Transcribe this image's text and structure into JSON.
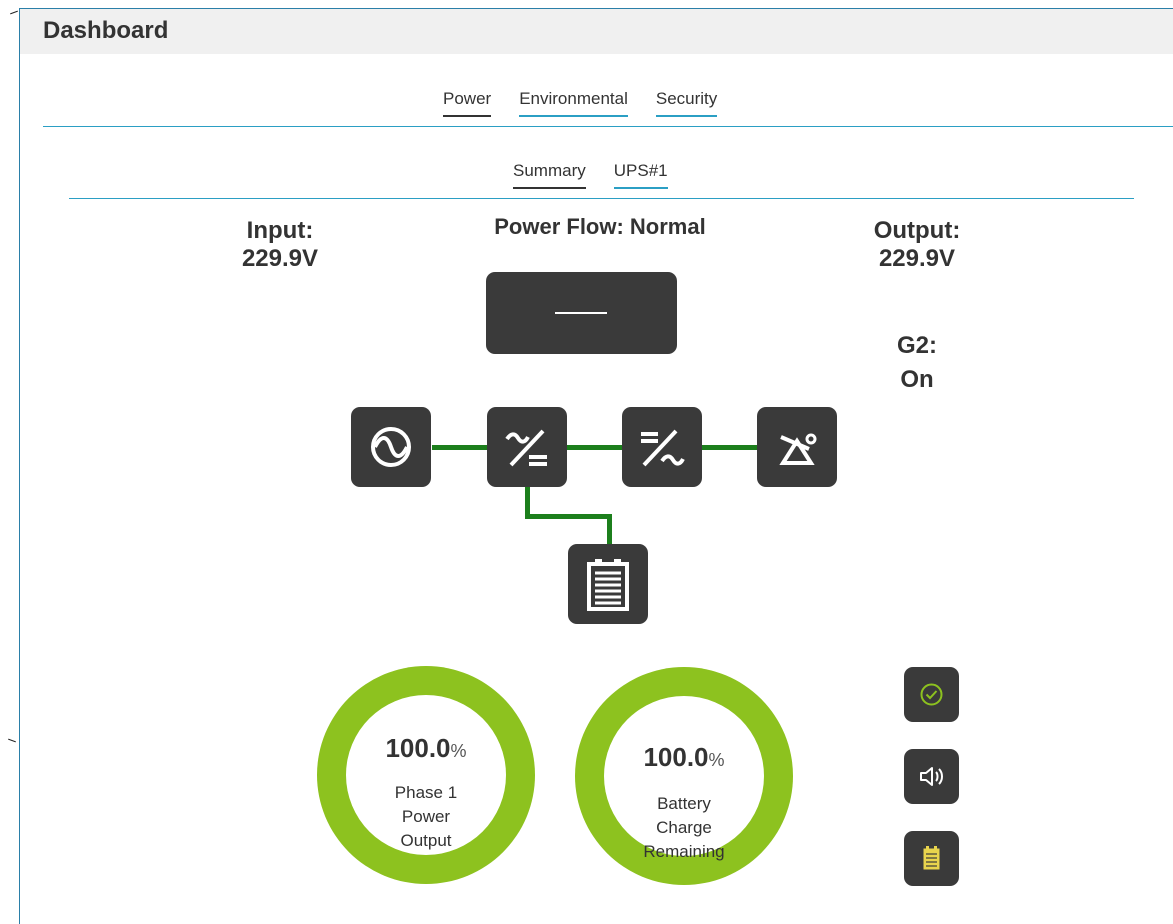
{
  "header": {
    "title": "Dashboard"
  },
  "main_tabs": [
    {
      "label": "Power",
      "active": true
    },
    {
      "label": "Environmental",
      "active": false
    },
    {
      "label": "Security",
      "active": false
    }
  ],
  "sub_tabs": [
    {
      "label": "Summary",
      "active": true
    },
    {
      "label": "UPS#1",
      "active": false
    }
  ],
  "input": {
    "label": "Input:",
    "value": "229.9V"
  },
  "power_flow": {
    "label": "Power Flow: Normal"
  },
  "output": {
    "label": "Output:",
    "value": "229.9V"
  },
  "g2": {
    "label": "G2:",
    "value": "On"
  },
  "flow_nodes": [
    {
      "icon": "ac-input-icon"
    },
    {
      "icon": "rectifier-icon"
    },
    {
      "icon": "inverter-icon"
    },
    {
      "icon": "bypass-switch-icon"
    },
    {
      "icon": "battery-icon"
    }
  ],
  "gauges": [
    {
      "value": "100.0",
      "unit": "%",
      "label_lines": [
        "Phase 1",
        "Power",
        "Output"
      ],
      "fraction": 1.0
    },
    {
      "value": "100.0",
      "unit": "%",
      "label_lines": [
        "Battery",
        "Charge",
        "Remaining"
      ],
      "fraction": 1.0
    }
  ],
  "status_buttons": [
    {
      "icon": "check-circle-icon"
    },
    {
      "icon": "speaker-icon"
    },
    {
      "icon": "battery-status-icon"
    }
  ],
  "colors": {
    "accent": "#2b9fc4",
    "node_bg": "#3a3a3a",
    "flow_line": "#1c7f1c",
    "gauge_ring": "#8dc21f",
    "ok_green": "#8dc21f",
    "battery_yellow": "#e8d44d"
  }
}
